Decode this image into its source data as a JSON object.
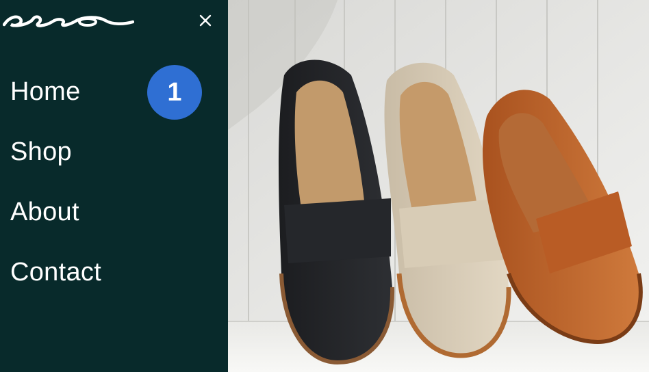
{
  "brand": {
    "logo_icon": "script-logo"
  },
  "menu": {
    "close_icon": "close-icon",
    "items": [
      {
        "label": "Home"
      },
      {
        "label": "Shop"
      },
      {
        "label": "About"
      },
      {
        "label": "Contact"
      }
    ],
    "badge": "1"
  },
  "hero": {
    "image": "three-penny-loafers-on-white-paneling"
  },
  "colors": {
    "sidebar": "#082a2b",
    "badge": "#2f6fd3",
    "text": "#ffffff"
  }
}
